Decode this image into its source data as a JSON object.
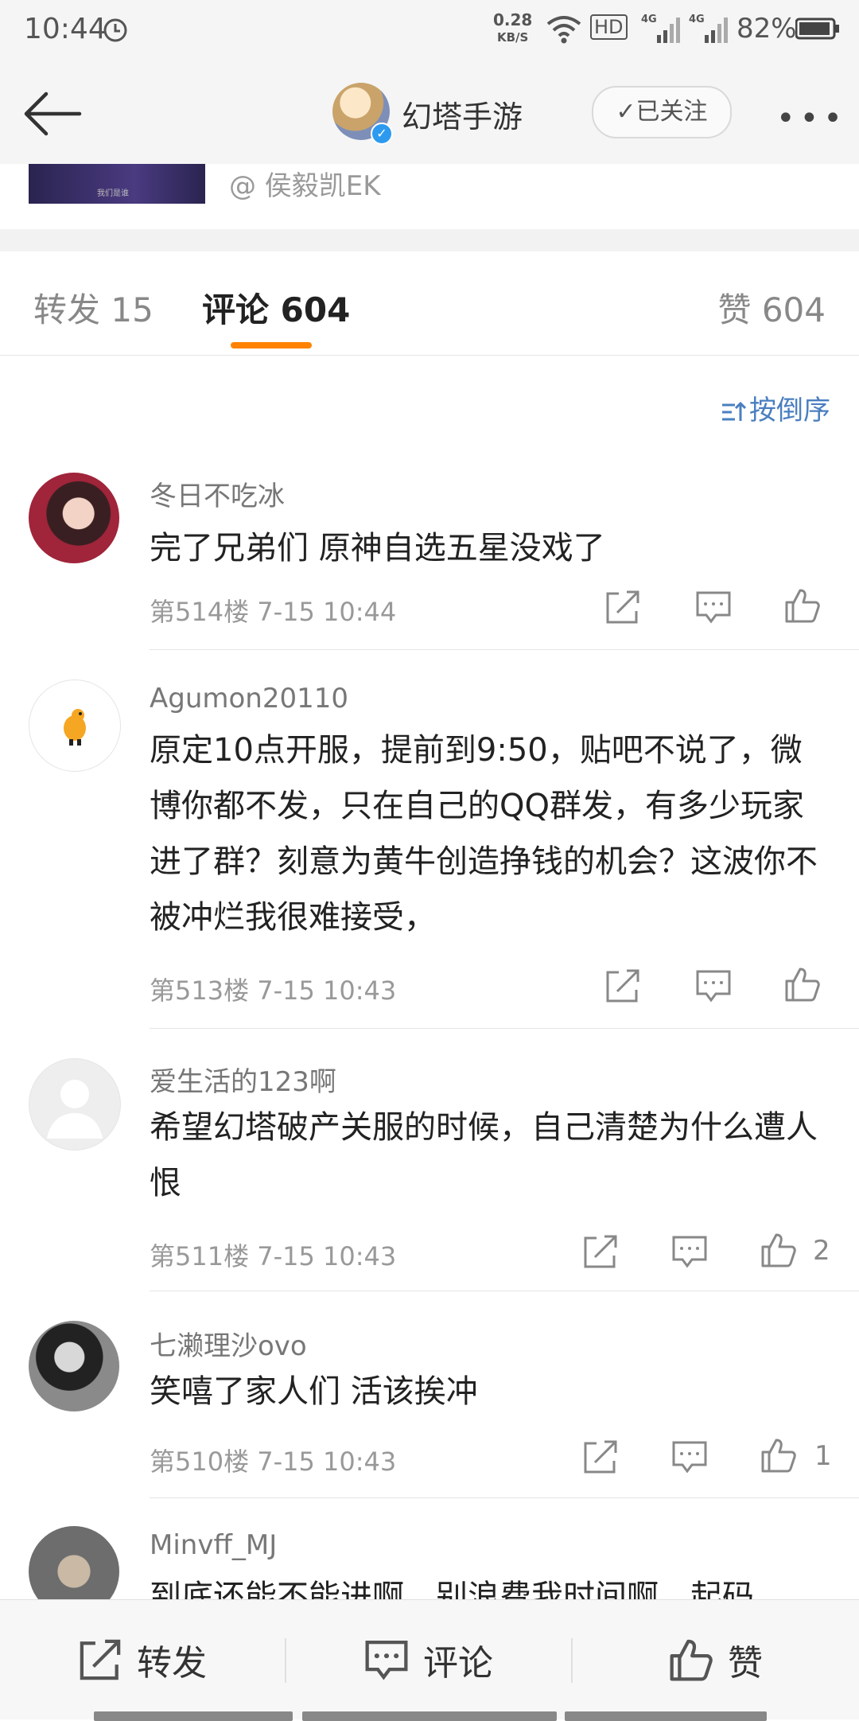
{
  "status_bar": {
    "time": "10:44",
    "net_speed_value": "0.28",
    "net_speed_unit": "KB/S",
    "hd_label": "HD",
    "signal_label": "4G",
    "battery_percent": "82%"
  },
  "nav": {
    "title": "幻塔手游",
    "follow_label": "✓已关注",
    "more_label": "•••"
  },
  "repost_card": {
    "author": "@ 侯毅凯EK",
    "thumb_caption": "我们是谁"
  },
  "tabs": {
    "repost": "转发 15",
    "comment": "评论 604",
    "like": "赞 604"
  },
  "sort_label": "按倒序",
  "comments": [
    {
      "name": "冬日不吃冰",
      "text": "完了兄弟们 原神自选五星没戏了",
      "floor_time": "第514楼  7-15 10:44",
      "likes": ""
    },
    {
      "name": "Agumon20110",
      "text": "原定10点开服，提前到9:50，贴吧不说了，微博你都不发，只在自己的QQ群发，有多少玩家进了群？刻意为黄牛创造挣钱的机会？这波你不被冲烂我很难接受，",
      "floor_time": "第513楼  7-15 10:43",
      "likes": ""
    },
    {
      "name": "爱生活的123啊",
      "text": "希望幻塔破产关服的时候，自己清楚为什么遭人恨",
      "floor_time": "第511楼  7-15 10:43",
      "likes": "2"
    },
    {
      "name": "七濑理沙ovo",
      "text": "笑嘻了家人们  活该挨冲",
      "floor_time": "第510楼  7-15 10:43",
      "likes": "1"
    },
    {
      "name": "Minvff_MJ",
      "text": "到底还能不能进啊，别浪费我时间啊，起码",
      "floor_time": "",
      "likes": ""
    }
  ],
  "bottom_bar": {
    "repost": "转发",
    "comment": "评论",
    "like": "赞"
  },
  "colors": {
    "accent": "#ff8200",
    "link": "#4a7fc0",
    "verified": "#2d9af0"
  }
}
